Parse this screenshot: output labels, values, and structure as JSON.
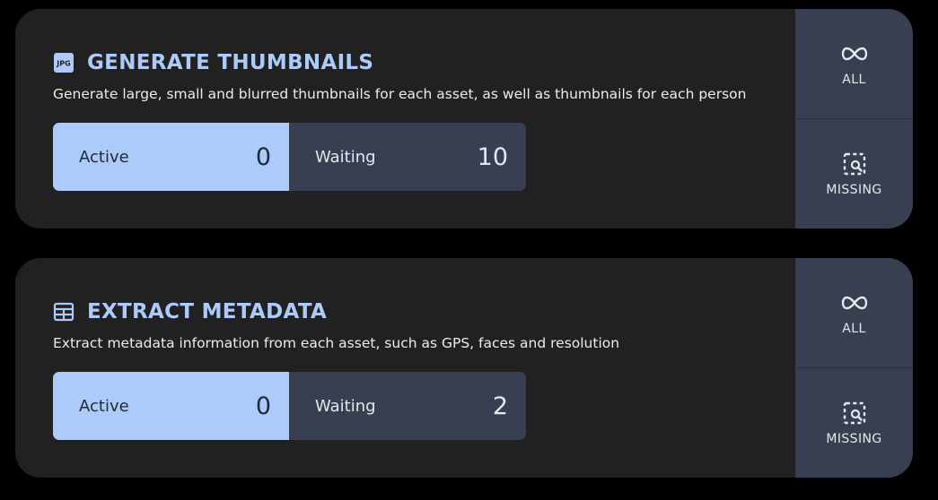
{
  "jobs": [
    {
      "icon": "jpg-file-icon",
      "title": "GENERATE THUMBNAILS",
      "description": "Generate large, small and blurred thumbnails for each asset, as well as thumbnails for each person",
      "active_label": "Active",
      "active_count": "0",
      "waiting_label": "Waiting",
      "waiting_count": "10",
      "actions": [
        {
          "icon": "infinity-icon",
          "label": "ALL"
        },
        {
          "icon": "missing-search-icon",
          "label": "MISSING"
        }
      ]
    },
    {
      "icon": "table-icon",
      "title": "EXTRACT METADATA",
      "description": "Extract metadata information from each asset, such as GPS, faces and resolution",
      "active_label": "Active",
      "active_count": "0",
      "waiting_label": "Waiting",
      "waiting_count": "2",
      "actions": [
        {
          "icon": "infinity-icon",
          "label": "ALL"
        },
        {
          "icon": "missing-search-icon",
          "label": "MISSING"
        }
      ]
    }
  ],
  "colors": {
    "background": "#000000",
    "card": "#212121",
    "accent": "#adcbfa",
    "panel": "#373f51",
    "text": "#ececec"
  }
}
